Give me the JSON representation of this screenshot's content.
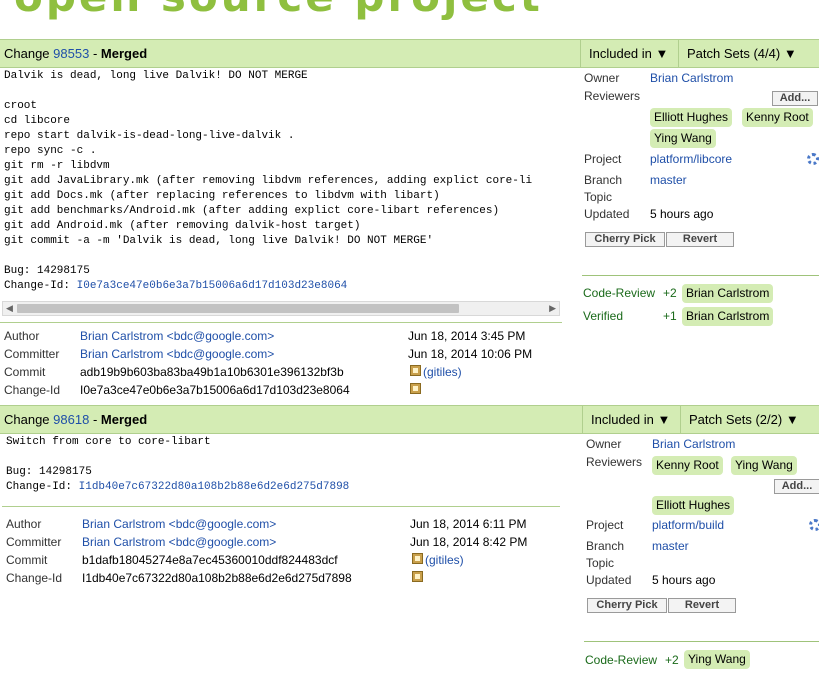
{
  "banner": {
    "text": "open source project"
  },
  "changes": [
    {
      "number": "98553",
      "status": "Merged",
      "prefix": "Change",
      "included_in": "Included in ▼",
      "patch_sets": "Patch Sets (4/4) ▼",
      "message_lines": [
        "Dalvik is dead, long live Dalvik! DO NOT MERGE",
        "",
        "croot",
        "cd libcore",
        "repo start dalvik-is-dead-long-live-dalvik .",
        "repo sync -c .",
        "git rm -r libdvm",
        "git add JavaLibrary.mk (after removing libdvm references, adding explict core-li",
        "git add Docs.mk (after replacing references to libdvm with libart)",
        "git add benchmarks/Android.mk (after adding explict core-libart references)",
        "git add Android.mk (after removing dalvik-host target)",
        "git commit -a -m 'Dalvik is dead, long live Dalvik! DO NOT MERGE'",
        "",
        "Bug: 14298175"
      ],
      "change_id_label": "Change-Id: ",
      "change_id_link": "I0e7a3ce47e0b6e3a7b15006a6d17d103d23e8064",
      "author_label": "Author",
      "author": "Brian Carlstrom <bdc@google.com>",
      "author_date": "Jun 18, 2014 3:45 PM",
      "committer_label": "Committer",
      "committer": "Brian Carlstrom <bdc@google.com>",
      "committer_date": "Jun 18, 2014 10:06 PM",
      "commit_label": "Commit",
      "commit": "adb19b9b603ba83ba49b1a10b6301e396132bf3b",
      "gitiles": "(gitiles)",
      "changeid_label": "Change-Id",
      "changeid": "I0e7a3ce47e0b6e3a7b15006a6d17d103d23e8064",
      "owner_label": "Owner",
      "owner": "Brian Carlstrom",
      "reviewers_label": "Reviewers",
      "add_label": "Add...",
      "reviewers": [
        "Elliott Hughes",
        "Kenny Root",
        "Ying Wang"
      ],
      "project_label": "Project",
      "project": "platform/libcore",
      "branch_label": "Branch",
      "branch": "master",
      "topic_label": "Topic",
      "topic": "",
      "updated_label": "Updated",
      "updated": "5 hours ago",
      "cherry_pick": "Cherry Pick",
      "revert": "Revert",
      "labels": [
        {
          "name": "Code-Review",
          "score": "+2",
          "who": "Brian Carlstrom"
        },
        {
          "name": "Verified",
          "score": "+1",
          "who": "Brian Carlstrom"
        }
      ]
    },
    {
      "number": "98618",
      "status": "Merged",
      "prefix": "Change",
      "included_in": "Included in ▼",
      "patch_sets": "Patch Sets (2/2) ▼",
      "message_lines": [
        "Switch from core to core-libart",
        "",
        "Bug: 14298175"
      ],
      "change_id_label": "Change-Id: ",
      "change_id_link": "I1db40e7c67322d80a108b2b88e6d2e6d275d7898",
      "author_label": "Author",
      "author": "Brian Carlstrom <bdc@google.com>",
      "author_date": "Jun 18, 2014 6:11 PM",
      "committer_label": "Committer",
      "committer": "Brian Carlstrom <bdc@google.com>",
      "committer_date": "Jun 18, 2014 8:42 PM",
      "commit_label": "Commit",
      "commit": "b1dafb18045274e8a7ec45360010ddf824483dcf",
      "gitiles": "(gitiles)",
      "changeid_label": "Change-Id",
      "changeid": "I1db40e7c67322d80a108b2b88e6d2e6d275d7898",
      "owner_label": "Owner",
      "owner": "Brian Carlstrom",
      "reviewers_label": "Reviewers",
      "add_label": "Add...",
      "reviewers": [
        "Kenny Root",
        "Ying Wang",
        "Elliott Hughes"
      ],
      "project_label": "Project",
      "project": "platform/build",
      "branch_label": "Branch",
      "branch": "master",
      "topic_label": "Topic",
      "topic": "",
      "updated_label": "Updated",
      "updated": "5 hours ago",
      "cherry_pick": "Cherry Pick",
      "revert": "Revert",
      "labels": [
        {
          "name": "Code-Review",
          "score": "+2",
          "who": "Ying Wang"
        }
      ]
    }
  ]
}
